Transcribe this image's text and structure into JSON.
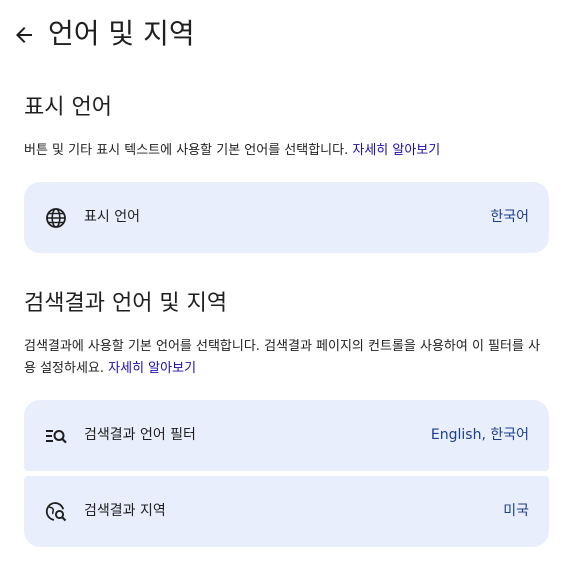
{
  "header": {
    "title": "언어 및 지역",
    "back_icon": "arrow-left-icon"
  },
  "display_language": {
    "title": "표시 언어",
    "description": "버튼 및 기타 표시 텍스트에 사용할 기본 언어를 선택합니다.",
    "learn_more": "자세히 알아보기",
    "item": {
      "icon": "globe-icon",
      "label": "표시 언어",
      "value": "한국어"
    }
  },
  "search_results": {
    "title": "검색결과 언어 및 지역",
    "description": "검색결과에 사용할 기본 언어를 선택합니다. 검색결과 페이지의 컨트롤을 사용하여 이 필터를 사용 설정하세요.",
    "learn_more": "자세히 알아보기",
    "items": [
      {
        "icon": "filter-search-icon",
        "label": "검색결과 언어 필터",
        "value": "English, 한국어"
      },
      {
        "icon": "region-search-icon",
        "label": "검색결과 지역",
        "value": "미국"
      }
    ]
  },
  "colors": {
    "card_background": "#e9eefd",
    "link": "#1a0dab",
    "text": "#1f1f1f",
    "value_text": "#1a3f8f"
  }
}
